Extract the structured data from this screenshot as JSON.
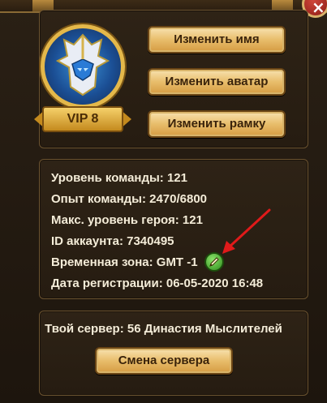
{
  "profile": {
    "vip_label": "VIP 8",
    "change_name_label": "Изменить имя",
    "change_avatar_label": "Изменить аватар",
    "change_frame_label": "Изменить рамку"
  },
  "info": {
    "team_level": "Уровень команды: 121",
    "team_exp": "Опыт команды: 2470/6800",
    "max_hero_level": "Макс. уровень героя: 121",
    "account_id": "ID аккаунта: 7340495",
    "time_zone": "Временная зона: GMT -1",
    "reg_date": "Дата регистрации: 06-05-2020 16:48"
  },
  "server": {
    "current": "Твой сервер: 56 Династия Мыслителей",
    "change_label": "Смена сервера"
  },
  "colors": {
    "button_gold": "#e8bd6b",
    "panel_bg": "#2a2015",
    "text": "#f4ecd8",
    "arrow": "#e01a1a",
    "edit_icon": "#4fbf33"
  }
}
